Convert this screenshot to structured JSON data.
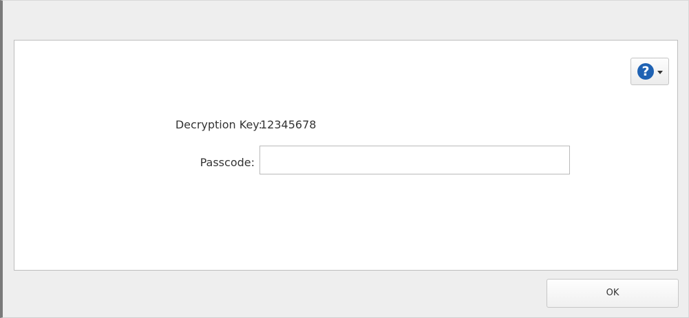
{
  "form": {
    "decryption_key_label": "Decryption Key:",
    "decryption_key_value": "12345678",
    "passcode_label": "Passcode:",
    "passcode_value": "",
    "passcode_placeholder": ""
  },
  "help": {
    "icon_glyph": "?",
    "icon": "help-icon",
    "dropdown_icon": "caret-down-icon",
    "accent_color": "#1f62b3"
  },
  "footer": {
    "ok_label": "OK"
  }
}
